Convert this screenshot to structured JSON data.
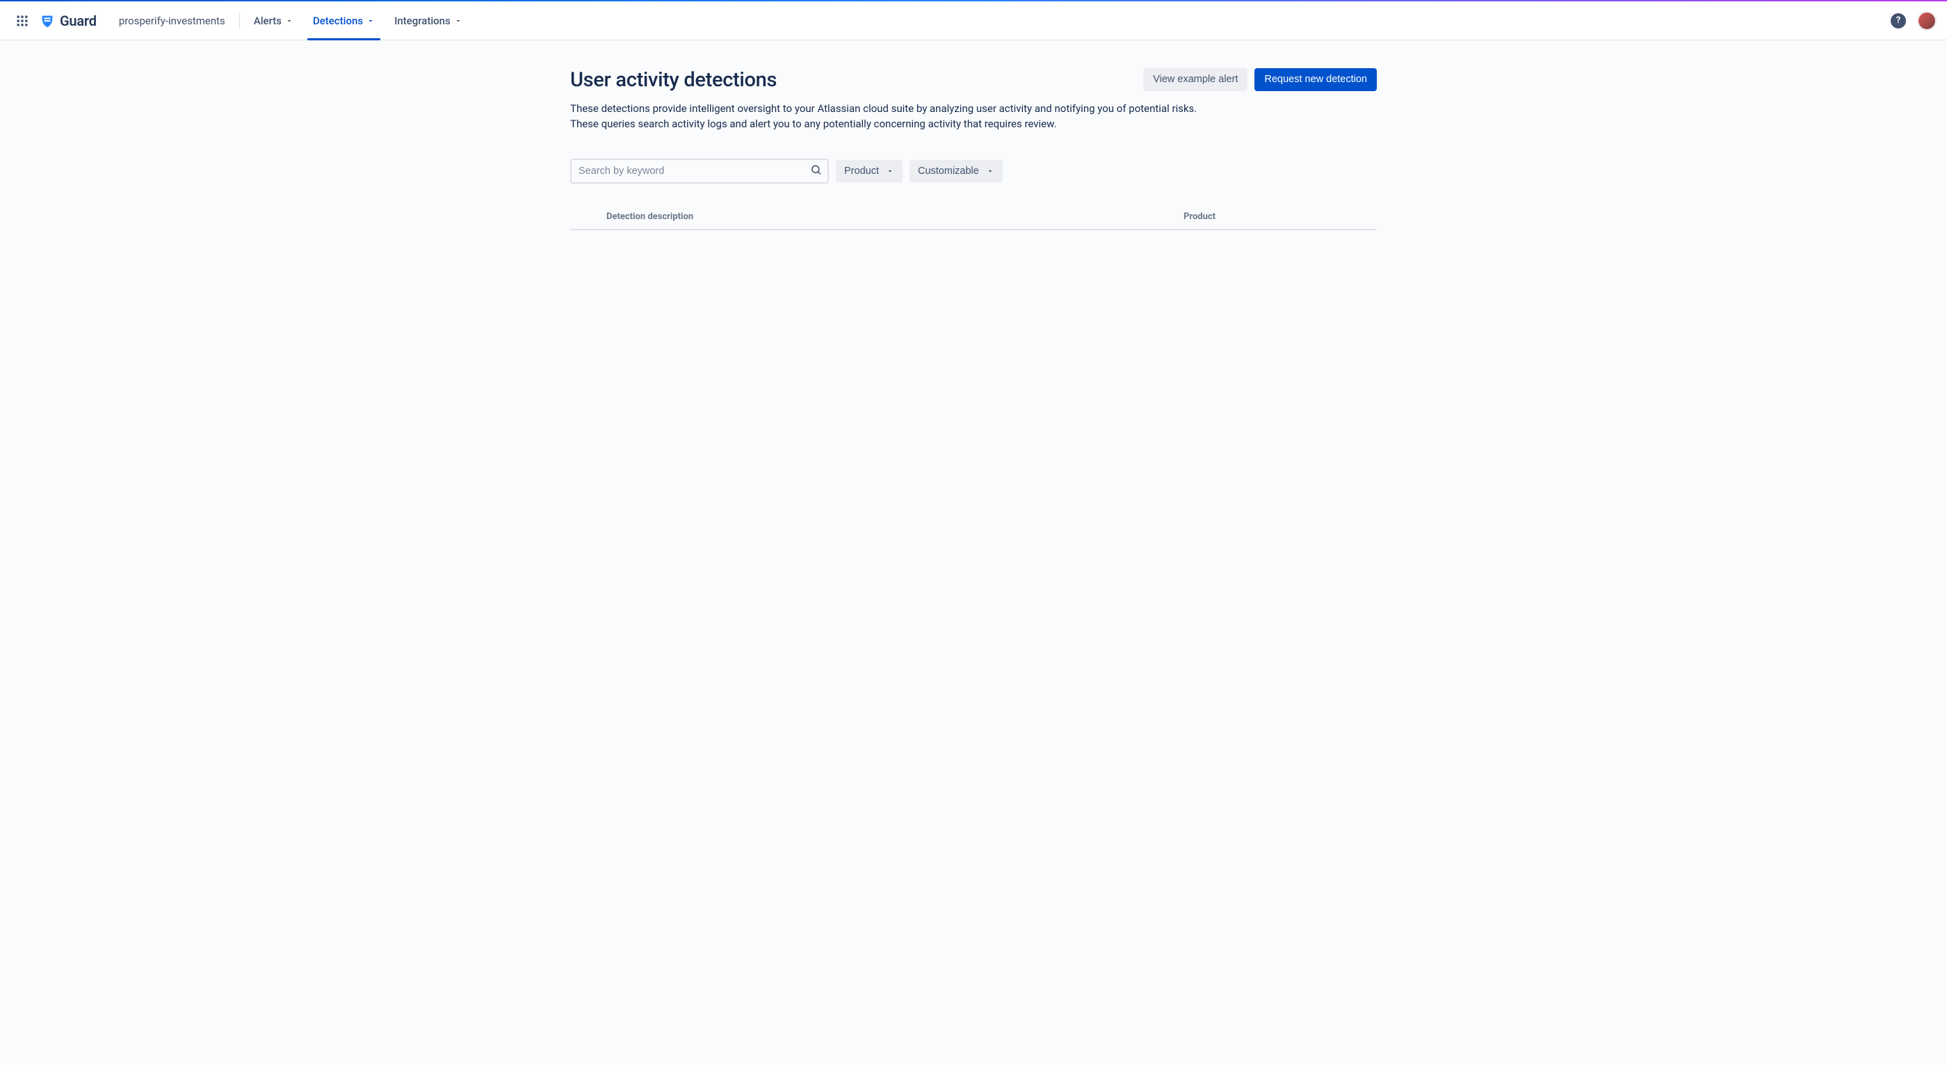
{
  "header": {
    "brand_name": "Guard",
    "org_name": "prosperify-investments",
    "tabs": [
      {
        "label": "Alerts",
        "active": false
      },
      {
        "label": "Detections",
        "active": true
      },
      {
        "label": "Integrations",
        "active": false
      }
    ]
  },
  "page": {
    "title": "User activity detections",
    "description": "These detections provide intelligent oversight to your Atlassian cloud suite by analyzing user activity and notifying you of potential risks. These queries search activity logs and alert you to any potentially concerning activity that requires review.",
    "actions": {
      "view_example": "View example alert",
      "request_new": "Request new detection"
    }
  },
  "filters": {
    "search_placeholder": "Search by keyword",
    "product_label": "Product",
    "customizable_label": "Customizable"
  },
  "table": {
    "columns": {
      "description": "Detection description",
      "product": "Product"
    },
    "rows": []
  }
}
